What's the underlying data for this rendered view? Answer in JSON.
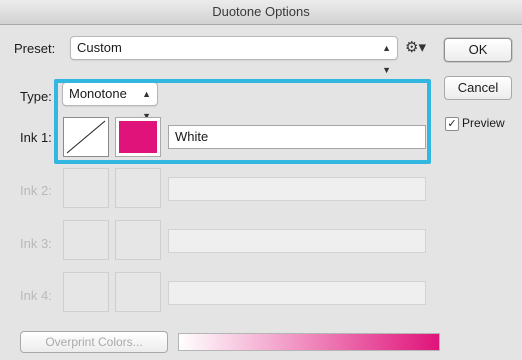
{
  "window": {
    "title": "Duotone Options"
  },
  "preset": {
    "label": "Preset:",
    "value": "Custom",
    "gear_icon": "gear-icon"
  },
  "buttons": {
    "ok": "OK",
    "cancel": "Cancel"
  },
  "preview": {
    "label": "Preview",
    "checked": true,
    "check": "✓"
  },
  "type": {
    "label": "Type:",
    "value": "Monotone"
  },
  "inks": [
    {
      "label": "Ink 1:",
      "name": "White",
      "color": "#e0137a",
      "enabled": true
    },
    {
      "label": "Ink 2:",
      "name": "",
      "enabled": false
    },
    {
      "label": "Ink 3:",
      "name": "",
      "enabled": false
    },
    {
      "label": "Ink 4:",
      "name": "",
      "enabled": false
    }
  ],
  "overprint": {
    "label": "Overprint Colors...",
    "gradient_start": "#ffffff",
    "gradient_end": "#e0137a"
  },
  "colors": {
    "highlight": "#33b6e0"
  }
}
